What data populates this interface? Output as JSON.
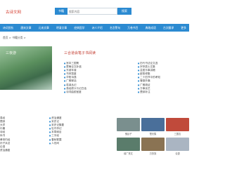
{
  "logo": "古诗文网",
  "search": {
    "select": "书籍",
    "placeholder": "搜索内容",
    "button": "搜索"
  },
  "nav": [
    "诗词赏析",
    "唐宋文章",
    "元宋文章",
    "明清文章",
    "经典国学",
    "诗人介绍",
    "名言警句",
    "万卷书目",
    "典故成语",
    "古文翻译",
    "更多"
  ],
  "breadcrumb": "首页 > 书籍分类 >",
  "featured": {
    "title": "三夜游",
    "right_title": "三合道会笔子书阅读"
  },
  "list_a": [
    "宫本三国策",
    "蒙庵论文补遗",
    "东坡年谱",
    "书林藻鉴",
    "华阳诗逸",
    "广雅释话",
    "若溪丛记",
    "易经原义与记白话",
    "诗词曲韵宝鉴"
  ],
  "list_b": [
    "历代书法论文选",
    "宗亭居士文集",
    "芸居乐事讲稿",
    "欧阳修集",
    "二十四节中的孝知",
    "管窥外篇",
    "广雅疏证",
    "万事谈艺",
    "楚辞补注"
  ],
  "list_c": [
    "易经",
    "楚辞",
    "大学",
    "中庸",
    "诗经",
    "尚书",
    "黄帝内经",
    "孙子兵法",
    "论语",
    "资治通鉴"
  ],
  "list_d": [
    "资治通鉴",
    "宋史记",
    "宋史记集要",
    "牡丹亭记",
    "本草纲目",
    "三字经",
    "春秋繁露",
    "人世间"
  ],
  "thumbs": [
    {
      "caption": "鬼谷子",
      "color": "#7a8f8e"
    },
    {
      "caption": "楚天集",
      "color": "#4a6f9a"
    },
    {
      "caption": "三国志",
      "color": "#c04a3b"
    },
    {
      "caption": "增广贤文",
      "color": "#5a7c6b"
    },
    {
      "caption": "万历奴",
      "color": "#8a7353"
    },
    {
      "caption": "论语",
      "color": "#aab5c2"
    }
  ]
}
